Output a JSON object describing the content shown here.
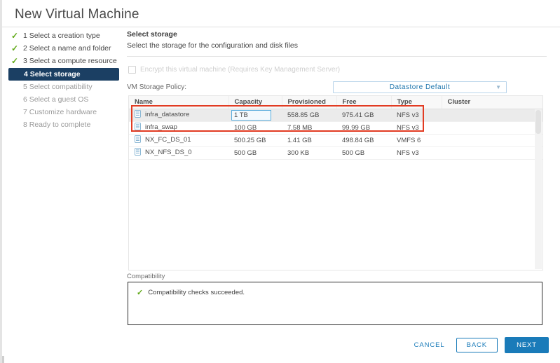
{
  "window": {
    "title": "New Virtual Machine"
  },
  "steps": [
    {
      "num": "1",
      "label": "1 Select a creation type",
      "state": "done"
    },
    {
      "num": "2",
      "label": "2 Select a name and folder",
      "state": "done"
    },
    {
      "num": "3",
      "label": "3 Select a compute resource",
      "state": "done"
    },
    {
      "num": "4",
      "label": "4 Select storage",
      "state": "active"
    },
    {
      "num": "5",
      "label": "5 Select compatibility",
      "state": "pending"
    },
    {
      "num": "6",
      "label": "6 Select a guest OS",
      "state": "pending"
    },
    {
      "num": "7",
      "label": "7 Customize hardware",
      "state": "pending"
    },
    {
      "num": "8",
      "label": "8 Ready to complete",
      "state": "pending"
    }
  ],
  "panel": {
    "title": "Select storage",
    "subtitle": "Select the storage for the configuration and disk files"
  },
  "encrypt": {
    "label": "Encrypt this virtual machine (Requires Key Management Server)",
    "checked": false
  },
  "storage_policy": {
    "label": "VM Storage Policy:",
    "value": "Datastore Default",
    "caret": "chevron-down-icon"
  },
  "table": {
    "columns": [
      "Name",
      "Capacity",
      "Provisioned",
      "Free",
      "Type",
      "Cluster"
    ],
    "rows": [
      {
        "name": "infra_datastore",
        "capacity": "1 TB",
        "provisioned": "558.85 GB",
        "free": "975.41 GB",
        "type": "NFS v3",
        "cluster": "",
        "selected": true,
        "capacity_focused": true
      },
      {
        "name": "infra_swap",
        "capacity": "100 GB",
        "provisioned": "7.58 MB",
        "free": "99.99 GB",
        "type": "NFS v3",
        "cluster": "",
        "selected": false,
        "capacity_focused": false
      },
      {
        "name": "NX_FC_DS_01",
        "capacity": "500.25 GB",
        "provisioned": "1.41 GB",
        "free": "498.84 GB",
        "type": "VMFS 6",
        "cluster": "",
        "selected": false,
        "capacity_focused": false
      },
      {
        "name": "NX_NFS_DS_0",
        "capacity": "500 GB",
        "provisioned": "300 KB",
        "free": "500 GB",
        "type": "NFS v3",
        "cluster": "",
        "selected": false,
        "capacity_focused": false
      }
    ]
  },
  "compatibility": {
    "label": "Compatibility",
    "message": "Compatibility checks succeeded."
  },
  "footer": {
    "cancel": "CANCEL",
    "back": "BACK",
    "next": "NEXT"
  },
  "colors": {
    "accent_blue": "#1a7bb9",
    "active_step_bg": "#1b3f63",
    "success_green": "#60a917",
    "annotation_red": "#e23b22",
    "datastore_icon": "#8ab7d4"
  }
}
